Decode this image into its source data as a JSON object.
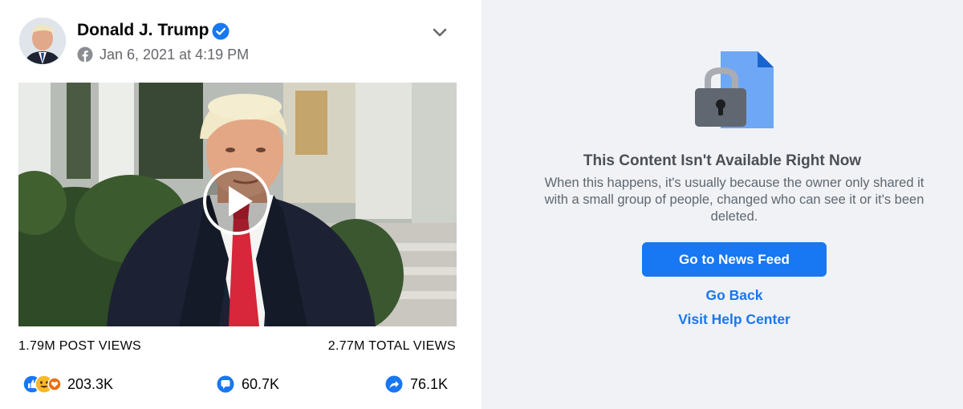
{
  "post": {
    "author": "Donald J. Trump",
    "verified": true,
    "timestamp": "Jan 6, 2021 at 4:19 PM",
    "privacy_icon": "facebook-icon",
    "menu_icon": "chevron-down-icon"
  },
  "video": {
    "play_icon": "play-icon"
  },
  "stats": {
    "post_views": "1.79M POST VIEWS",
    "total_views": "2.77M TOTAL VIEWS",
    "reactions": "203.3K",
    "comments": "60.7K",
    "shares": "76.1K"
  },
  "unavailable": {
    "title": "This Content Isn't Available Right Now",
    "description": "When this happens, it's usually because the owner only shared it with a small group of people, changed who can see it or it's been deleted.",
    "primary_button": "Go to News Feed",
    "go_back": "Go Back",
    "help_center": "Visit Help Center"
  },
  "colors": {
    "brand_blue": "#1877f2",
    "panel_bg": "#f0f2f5",
    "secondary_text": "#65676b"
  }
}
